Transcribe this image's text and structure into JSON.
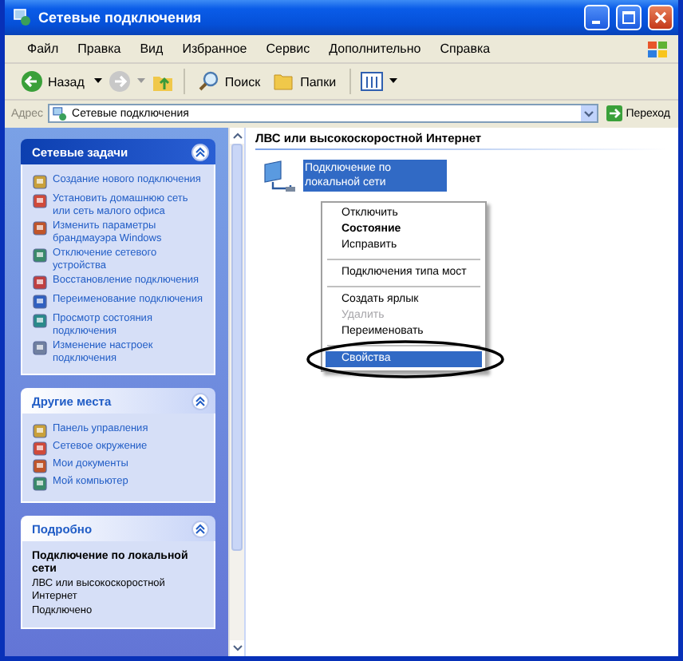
{
  "window": {
    "title": "Сетевые подключения"
  },
  "menu_bar": [
    "Файл",
    "Правка",
    "Вид",
    "Избранное",
    "Сервис",
    "Дополнительно",
    "Справка"
  ],
  "toolbar": {
    "back": "Назад",
    "search": "Поиск",
    "folders": "Папки"
  },
  "address_bar": {
    "label": "Адрес",
    "value": "Сетевые подключения",
    "go": "Переход"
  },
  "sidebar": [
    {
      "kind": "tasks",
      "title": "Сетевые задачи",
      "expanded": true,
      "items": [
        "Создание нового подключения",
        "Установить домашнюю сеть или сеть малого офиса",
        "Изменить параметры брандмауэра Windows",
        "Отключение сетевого устройства",
        "Восстановление подключения",
        "Переименование подключения",
        "Просмотр состояния подключения",
        "Изменение настроек подключения"
      ]
    },
    {
      "kind": "places",
      "title": "Другие места",
      "expanded": true,
      "items": [
        "Панель управления",
        "Сетевое окружение",
        "Мои документы",
        "Мой компьютер"
      ]
    },
    {
      "kind": "details",
      "title": "Подробно",
      "expanded": true,
      "heading": "Подключение по локальной сети",
      "items": [
        "ЛВС или высокоскоростной Интернет",
        "Подключено"
      ]
    }
  ],
  "content": {
    "group_title": "ЛВС или высокоскоростной Интернет",
    "connection": {
      "label": "Подключение по локальной сети",
      "selected": true
    },
    "context_menu": {
      "groups": [
        [
          {
            "label": "Отключить",
            "default": false,
            "disabled": false,
            "selected": false
          },
          {
            "label": "Состояние",
            "default": true,
            "disabled": false,
            "selected": false
          },
          {
            "label": "Исправить",
            "default": false,
            "disabled": false,
            "selected": false
          }
        ],
        [
          {
            "label": "Подключения типа мост",
            "default": false,
            "disabled": false,
            "selected": false
          }
        ],
        [
          {
            "label": "Создать ярлык",
            "default": false,
            "disabled": false,
            "selected": false
          },
          {
            "label": "Удалить",
            "default": false,
            "disabled": true,
            "selected": false
          },
          {
            "label": "Переименовать",
            "default": false,
            "disabled": false,
            "selected": false
          }
        ],
        [
          {
            "label": "Свойства",
            "default": false,
            "disabled": false,
            "selected": true
          }
        ]
      ]
    }
  }
}
